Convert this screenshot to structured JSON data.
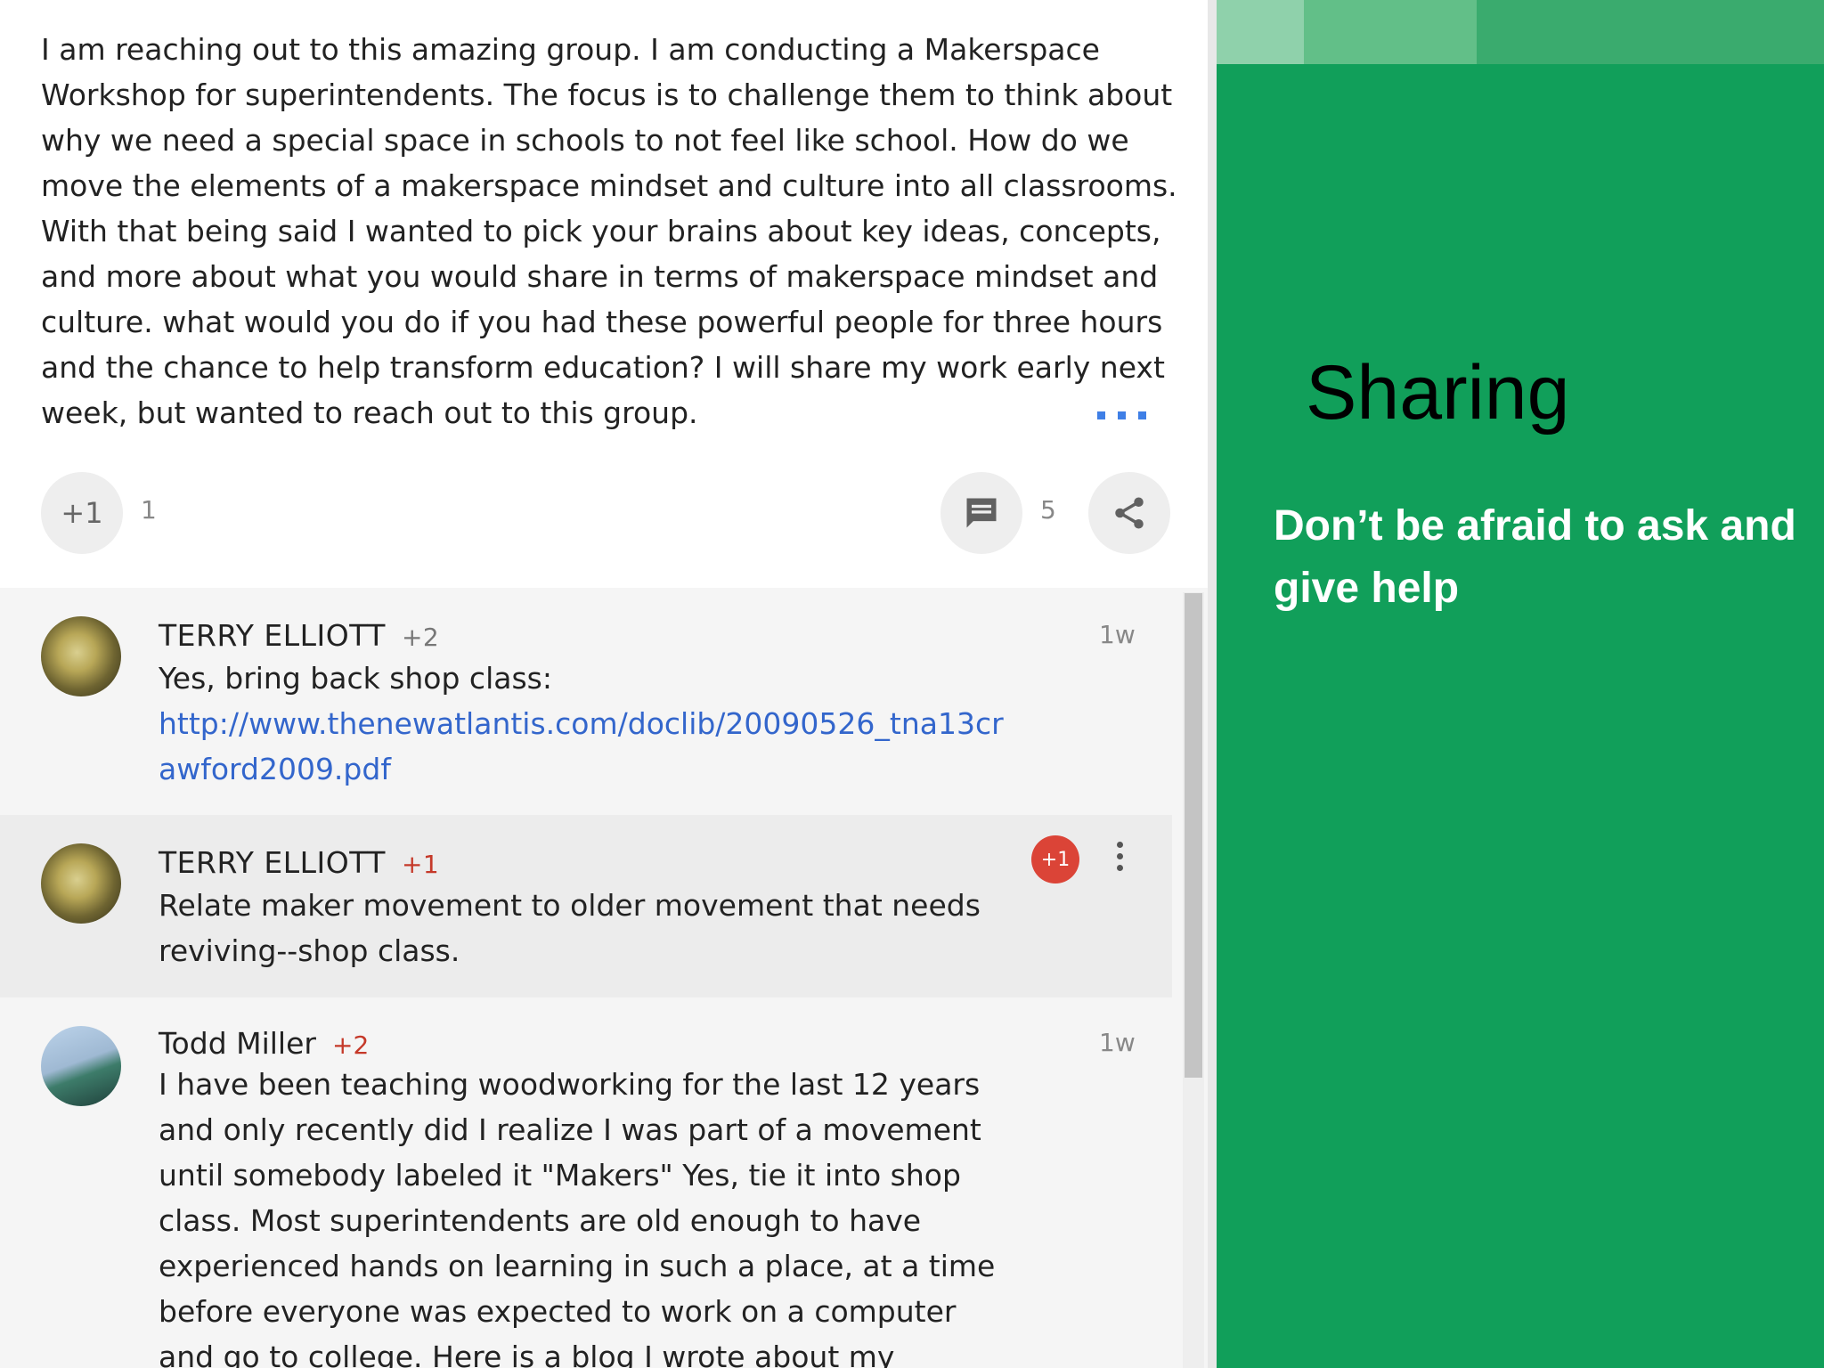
{
  "post": {
    "body": "I am reaching out to this amazing group. I am conducting a Makerspace Workshop for superintendents. The focus is to challenge them to think about why we need a special space in schools to not feel like school. How do we move the elements of a makerspace mindset and culture into all classrooms. With that being said I wanted to pick your brains about key ideas, concepts, and more about what you would share in terms of makerspace mindset and culture. what would you do if you had these powerful people for three hours and the chance to help transform education? I will share my work early next week, but wanted to reach out to this group.",
    "plusone_label": "+1",
    "plusone_count": "1",
    "comment_count": "5"
  },
  "comments": [
    {
      "author": "TERRY ELLIOTT",
      "plus": "+2",
      "time": "1w",
      "text": "Yes, bring back shop class:",
      "link": "http://www.thenewatlantis.com/doclib/20090526_tna13crawford2009.pdf"
    },
    {
      "author": "TERRY ELLIOTT",
      "plus": "+1",
      "badge": "+1",
      "text": "Relate maker movement to older movement that needs reviving--shop class."
    },
    {
      "author": "Todd Miller",
      "plus": "+2",
      "time": "1w",
      "text": "I have been teaching woodworking for the last 12 years and only recently did I realize I was part of a movement until somebody labeled it \"Makers\" Yes, tie it into shop class. Most superintendents are old enough to have experienced hands on learning in such a place, at a time before everyone was expected to work on a computer and go to college. Here is a blog I wrote about my philosophy. Enjoy. Todd"
    }
  ],
  "slide": {
    "title": "Sharing",
    "subtitle": "Don’t be afraid to ask and give help",
    "colors": {
      "background": "#119f5a",
      "band": [
        "#8fd1ab",
        "#62bf88",
        "#3aab6e"
      ]
    }
  },
  "icons": {
    "comment": "comment-icon",
    "share": "share-icon",
    "more": "more-dots-icon",
    "menu": "overflow-menu-icon"
  }
}
